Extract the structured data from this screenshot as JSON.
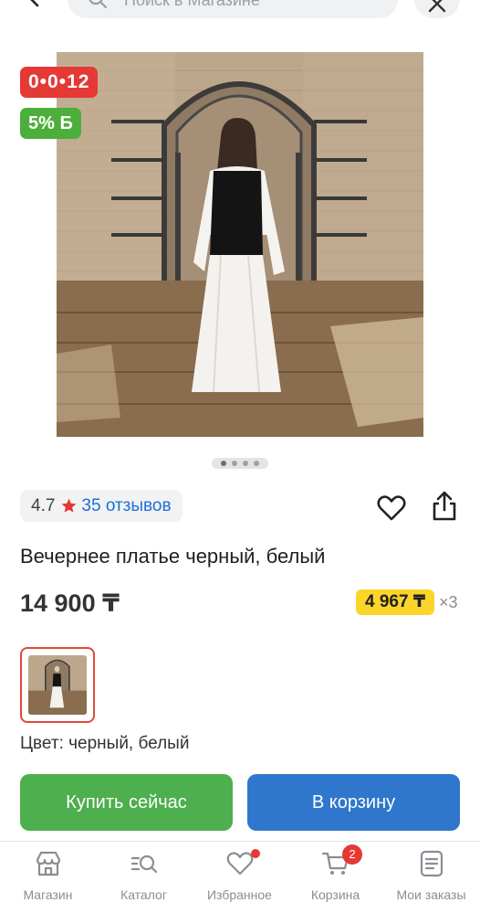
{
  "search": {
    "placeholder": "Поиск в Магазине"
  },
  "product": {
    "timer": "0•0•12",
    "bonus": "5% Б",
    "rating": "4.7",
    "reviews": "35 отзывов",
    "title": "Вечернее платье черный, белый",
    "price": "14 900 ₸",
    "installment": "4 967 ₸",
    "installment_multiplier": "×3",
    "color": "Цвет: черный, белый"
  },
  "gallery": {
    "slides": 4,
    "active_slide": 1
  },
  "actions": {
    "buy_now": "Купить сейчас",
    "add_to_cart": "В корзину"
  },
  "tabbar": {
    "items": [
      {
        "label": "Магазин",
        "icon": "shop-icon"
      },
      {
        "label": "Каталог",
        "icon": "catalog-search-icon"
      },
      {
        "label": "Избранное",
        "icon": "heart-icon"
      },
      {
        "label": "Корзина",
        "icon": "cart-icon"
      },
      {
        "label": "Мои заказы",
        "icon": "orders-icon"
      }
    ],
    "cart_badge": "2"
  },
  "colors": {
    "timer_bg": "#e53935",
    "bonus_bg": "#4caf3b",
    "buy_now_bg": "#4daf4e",
    "add_to_cart_bg": "#2f77cc",
    "installment_bg": "#fbd529",
    "link": "#1d6fd6"
  }
}
